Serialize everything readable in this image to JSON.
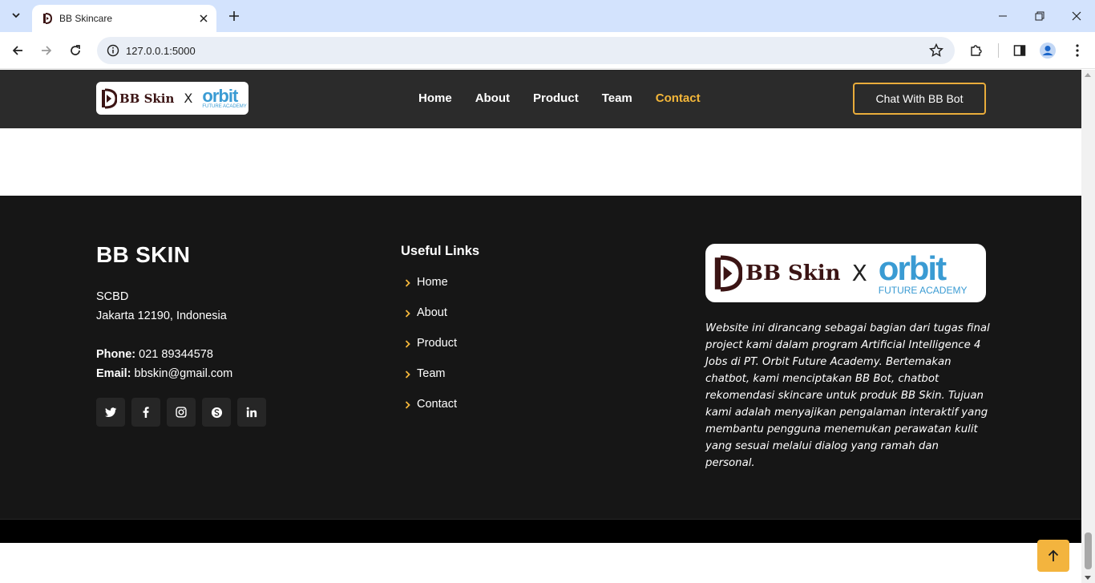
{
  "browser": {
    "tab_title": "BB Skincare",
    "url": "127.0.0.1:5000"
  },
  "header": {
    "logo_left": "BB Skin",
    "logo_x": "X",
    "logo_right": "orbit",
    "logo_right_sub": "FUTURE ACADEMY",
    "nav": [
      "Home",
      "About",
      "Product",
      "Team",
      "Contact"
    ],
    "active_nav": "Contact",
    "chat_button": "Chat With BB Bot"
  },
  "footer": {
    "brand": "BB SKIN",
    "address_line1": "SCBD",
    "address_line2": "Jakarta 12190, Indonesia",
    "phone_label": "Phone:",
    "phone": "021 89344578",
    "email_label": "Email:",
    "email": "bbskin@gmail.com",
    "socials": [
      "twitter-icon",
      "facebook-icon",
      "instagram-icon",
      "skype-icon",
      "linkedin-icon"
    ],
    "links_title": "Useful Links",
    "links": [
      "Home",
      "About",
      "Product",
      "Team",
      "Contact"
    ],
    "description": "Website ini dirancang sebagai bagian dari tugas final project kami dalam program Artificial Intelligence 4 Jobs di PT. Orbit Future Academy. Bertemakan chatbot, kami menciptakan BB Bot, chatbot rekomendasi skincare untuk produk BB Skin. Tujuan kami adalah menyajikan pengalaman interaktif yang membantu pengguna menemukan perawatan kulit yang sesuai melalui dialog yang ramah dan personal."
  },
  "colors": {
    "accent": "#f4b73a",
    "header_bg": "#2b2b2b",
    "footer_bg": "#161616",
    "orbit_blue": "#3a9bd3"
  }
}
